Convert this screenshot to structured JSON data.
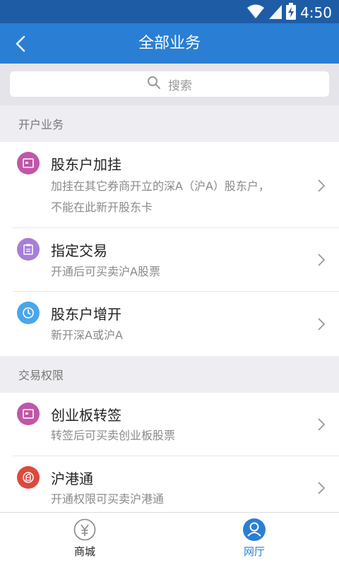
{
  "status_bar": {
    "time": "4:50",
    "wifi_icon": "wifi-icon",
    "signal_icon": "signal-icon",
    "battery_icon": "battery-charging-icon"
  },
  "header": {
    "title": "全部业务",
    "back_icon": "back-arrow-icon"
  },
  "search": {
    "placeholder": "搜索",
    "icon": "search-icon"
  },
  "sections": [
    {
      "title": "开户业务",
      "items": [
        {
          "title": "股东户加挂",
          "desc": "加挂在其它券商开立的深A（沪A）股东户，\n不能在此新开股东卡",
          "icon": "card-icon",
          "icon_color": "#c056a8"
        },
        {
          "title": "指定交易",
          "desc": "开通后可买卖沪A股票",
          "icon": "clipboard-icon",
          "icon_color": "#a77ed8"
        },
        {
          "title": "股东户增开",
          "desc": "新开深A或沪A",
          "icon": "clock-icon",
          "icon_color": "#4aa6ea"
        }
      ]
    },
    {
      "title": "交易权限",
      "items": [
        {
          "title": "创业板转签",
          "desc": "转签后可买卖创业板股票",
          "icon": "card-icon",
          "icon_color": "#c056a8"
        },
        {
          "title": "沪港通",
          "desc": "开通权限可买卖沪港通",
          "icon": "hk-connect-icon",
          "icon_color": "#dc4a3c"
        }
      ]
    }
  ],
  "tabs": [
    {
      "label": "商城",
      "icon": "yuan-coin-icon",
      "active": false
    },
    {
      "label": "网厅",
      "icon": "user-circle-icon",
      "active": true
    }
  ],
  "colors": {
    "status_bar": "#1e5da6",
    "title_bar": "#2a7fd4",
    "active_tab": "#2a7fd4",
    "inactive_tab": "#222222"
  }
}
